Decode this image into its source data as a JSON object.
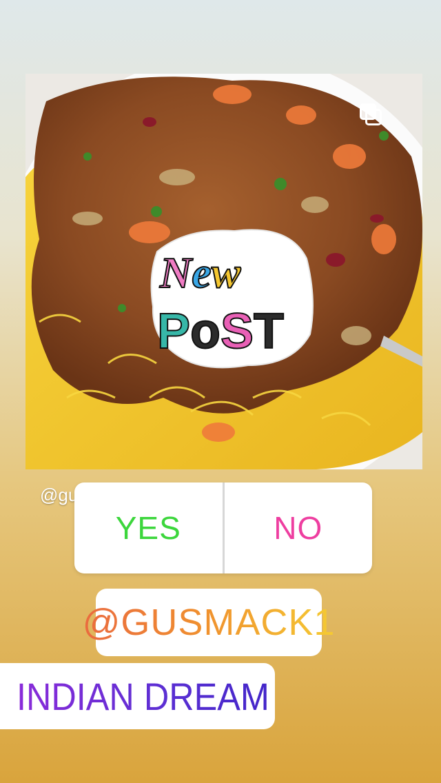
{
  "story": {
    "post_image": {
      "subject": "curry with rice on a plate",
      "colors": {
        "rice": "#f3c62c",
        "sauce": "#8a4a24",
        "plate": "#ffffff"
      }
    },
    "gallery_icon": "stacked-squares-icon",
    "sticker_new_post": {
      "line1": "New",
      "line2": "POST"
    },
    "credit_handle": "@gu",
    "poll": {
      "yes_label": "YES",
      "no_label": "NO",
      "yes_color": "#3cd63c",
      "no_color": "#ee3ea0"
    },
    "mention": {
      "label": "@GUSMACK1"
    },
    "location": {
      "icon": "location-pin-icon",
      "label": "INDIAN DREAM"
    }
  }
}
